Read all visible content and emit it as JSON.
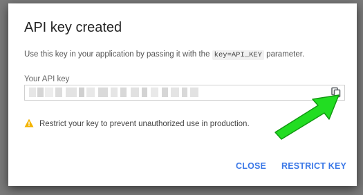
{
  "dialog": {
    "title": "API key created",
    "description_before": "Use this key in your application by passing it with the ",
    "description_code": "key=API_KEY",
    "description_after": " parameter.",
    "key_label": "Your API key",
    "key_value": "",
    "copy_icon": "copy-icon",
    "warning_icon": "warning-icon",
    "warning_text": "Restrict your key to prevent unauthorized use in production.",
    "close_label": "CLOSE",
    "restrict_label": "RESTRICT KEY"
  },
  "annotation": {
    "arrow_color": "#22dd22",
    "arrow_icon": "green-arrow-icon"
  },
  "colors": {
    "accent": "#3b78e7",
    "warning": "#f4b400",
    "overlay": "#7a7a7a"
  }
}
